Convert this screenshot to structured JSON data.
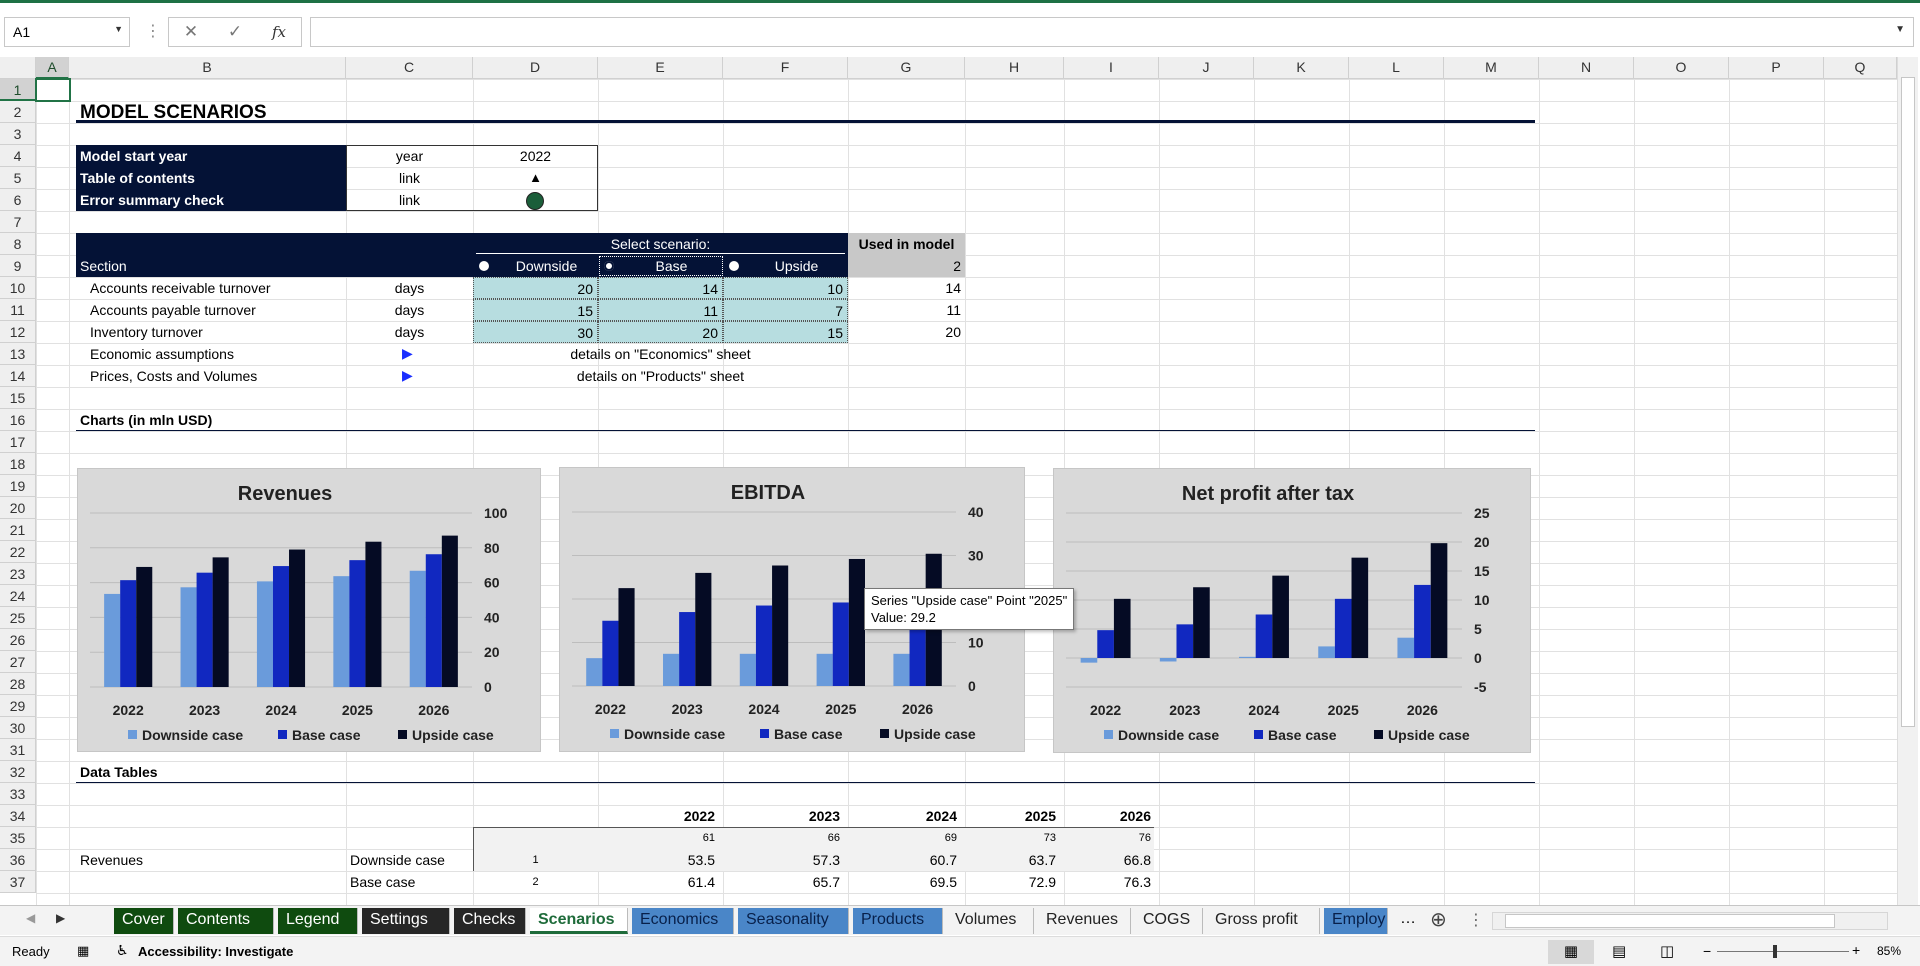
{
  "namebox": {
    "value": "A1"
  },
  "formula": {
    "value": ""
  },
  "columns": [
    "A",
    "B",
    "C",
    "D",
    "E",
    "F",
    "G",
    "H",
    "I",
    "J",
    "K",
    "L",
    "M",
    "N",
    "O",
    "P",
    "Q"
  ],
  "rows": [
    "1",
    "2",
    "3",
    "4",
    "5",
    "6",
    "7",
    "8",
    "9",
    "10",
    "11",
    "12",
    "13",
    "14",
    "15",
    "16",
    "17",
    "18",
    "19",
    "20",
    "21",
    "22",
    "23",
    "24",
    "25",
    "26",
    "27",
    "28",
    "29",
    "30",
    "31",
    "32",
    "33",
    "34",
    "35",
    "36",
    "37"
  ],
  "title": "MODEL SCENARIOS",
  "info": [
    {
      "label": "Model start year",
      "unit": "year",
      "value": "2022"
    },
    {
      "label": "Table of contents",
      "unit": "link",
      "value": "▲"
    },
    {
      "label": "Error summary check",
      "unit": "link",
      "value": ""
    }
  ],
  "scenario_header": {
    "select": "Select scenario:",
    "used": "Used in model",
    "section": "Section",
    "downside": "Downside",
    "base": "Base",
    "upside": "Upside",
    "used_value": "2"
  },
  "scenario_rows": [
    {
      "label": "Accounts receivable turnover",
      "unit": "days",
      "downside": "20",
      "base": "14",
      "upside": "10",
      "used": "14"
    },
    {
      "label": "Accounts payable turnover",
      "unit": "days",
      "downside": "15",
      "base": "11",
      "upside": "7",
      "used": "11"
    },
    {
      "label": "Inventory turnover",
      "unit": "days",
      "downside": "30",
      "base": "20",
      "upside": "15",
      "used": "20"
    }
  ],
  "detail_rows": [
    {
      "label": "Economic assumptions",
      "text": "details on \"Economics\" sheet"
    },
    {
      "label": "Prices, Costs and Volumes",
      "text": "details on \"Products\" sheet"
    }
  ],
  "charts_heading": "Charts (in mln USD)",
  "data_heading": "Data Tables",
  "data_table": {
    "years": [
      "2022",
      "2023",
      "2024",
      "2025",
      "2026"
    ],
    "row35": [
      "61",
      "66",
      "69",
      "73",
      "76"
    ],
    "row36": {
      "label": "Revenues",
      "case": "Downside case",
      "idx": "1",
      "values": [
        "53.5",
        "57.3",
        "60.7",
        "63.7",
        "66.8"
      ]
    },
    "row37": {
      "case": "Base case",
      "idx": "2",
      "values": [
        "61.4",
        "65.7",
        "69.5",
        "72.9",
        "76.3"
      ]
    }
  },
  "series_colors": {
    "downside": "#6a9bdb",
    "base": "#1128c0",
    "upside": "#050b24"
  },
  "chart_data": [
    {
      "type": "bar",
      "title": "Revenues",
      "categories": [
        "2022",
        "2023",
        "2024",
        "2025",
        "2026"
      ],
      "ylim": [
        0,
        100
      ],
      "yticks": [
        "100",
        "80",
        "60",
        "40",
        "20",
        "0"
      ],
      "series": [
        {
          "name": "Downside case",
          "values": [
            53.5,
            57.3,
            60.7,
            63.7,
            66.8
          ]
        },
        {
          "name": "Base case",
          "values": [
            61.4,
            65.7,
            69.5,
            72.9,
            76.3
          ]
        },
        {
          "name": "Upside case",
          "values": [
            69,
            74.5,
            79,
            83.5,
            87
          ]
        }
      ]
    },
    {
      "type": "bar",
      "title": "EBITDA",
      "categories": [
        "2022",
        "2023",
        "2024",
        "2025",
        "2026"
      ],
      "ylim": [
        0,
        40
      ],
      "yticks": [
        "40",
        "30",
        "20",
        "10",
        "0"
      ],
      "series": [
        {
          "name": "Downside case",
          "values": [
            6.4,
            7.4,
            7.4,
            7.4,
            7.4
          ]
        },
        {
          "name": "Base case",
          "values": [
            15,
            17,
            18.5,
            19.2,
            19.6
          ]
        },
        {
          "name": "Upside case",
          "values": [
            22.5,
            26,
            27.7,
            29.2,
            30.4
          ]
        }
      ]
    },
    {
      "type": "bar",
      "title": "Net profit after tax",
      "categories": [
        "2022",
        "2023",
        "2024",
        "2025",
        "2026"
      ],
      "ylim": [
        -5,
        25
      ],
      "yticks": [
        "25",
        "20",
        "15",
        "10",
        "5",
        "0",
        "-5"
      ],
      "series": [
        {
          "name": "Downside case",
          "values": [
            -0.8,
            -0.6,
            0.2,
            2,
            3.5
          ]
        },
        {
          "name": "Base case",
          "values": [
            4.8,
            5.8,
            7.5,
            10.2,
            12.6
          ]
        },
        {
          "name": "Upside case",
          "values": [
            10.2,
            12.2,
            14.2,
            17.3,
            19.8
          ]
        }
      ]
    }
  ],
  "tooltip": {
    "line1": "Series \"Upside case\" Point \"2025\"",
    "line2": "Value: 29.2"
  },
  "tabs": [
    {
      "label": "Cover",
      "bg": "#0f4b0f",
      "fg": "#fff"
    },
    {
      "label": "Contents",
      "bg": "#0f4b0f",
      "fg": "#fff"
    },
    {
      "label": "Legend",
      "bg": "#0f4b0f",
      "fg": "#fff"
    },
    {
      "label": "Settings",
      "bg": "#262626",
      "fg": "#fff"
    },
    {
      "label": "Checks",
      "bg": "#262626",
      "fg": "#fff"
    },
    {
      "label": "Scenarios",
      "bg": "#ffffff",
      "fg": "#1e6b3a",
      "active": true
    },
    {
      "label": "Economics",
      "bg": "#4a86c8",
      "fg": "#08204a"
    },
    {
      "label": "Seasonality",
      "bg": "#4a86c8",
      "fg": "#08204a"
    },
    {
      "label": "Products",
      "bg": "#4a86c8",
      "fg": "#08204a"
    },
    {
      "label": "Volumes",
      "bg": "#f3f3f3",
      "fg": "#222"
    },
    {
      "label": "Revenues",
      "bg": "#f3f3f3",
      "fg": "#222"
    },
    {
      "label": "COGS",
      "bg": "#f3f3f3",
      "fg": "#222"
    },
    {
      "label": "Gross profit",
      "bg": "#f3f3f3",
      "fg": "#222"
    },
    {
      "label": "Employ",
      "bg": "#4a86c8",
      "fg": "#08204a"
    }
  ],
  "status": {
    "ready": "Ready",
    "accessibility": "Accessibility: Investigate",
    "zoom": "85%"
  }
}
